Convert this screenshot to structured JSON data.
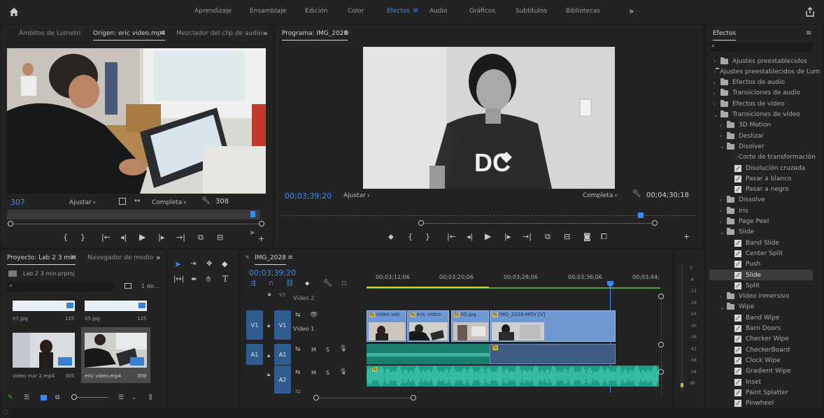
{
  "topbar": {
    "workspaces": [
      "Aprendizaje",
      "Ensamblaje",
      "Edición",
      "Color",
      "Efectos",
      "Audio",
      "Gráficos",
      "Subtítulos",
      "Bibliotecas"
    ],
    "active_workspace": "Efectos",
    "more": "»"
  },
  "source_panel": {
    "tabs": [
      "Ámbitos de Lumetri",
      "Origen: eric video.mp4",
      "Mezclador del clip de audio:"
    ],
    "active_tab": "Origen: eric video.mp4",
    "more": "»",
    "timecode_in": "307",
    "fit": "Ajustar",
    "quality": "Completa",
    "timecode_out": "308",
    "playhead_fraction": 0.98
  },
  "program_panel": {
    "title": "Programa: IMG_2028",
    "timecode_in": "00;03;39;20",
    "fit": "Ajustar",
    "quality": "Completa",
    "timecode_out": "00;04;30;18",
    "playhead_fraction": 0.96
  },
  "project_panel": {
    "tabs": [
      "Proyecto: Lab 2 3 min",
      "Navegador de medio"
    ],
    "active_tab": "Proyecto: Lab 2 3 min",
    "more": "»",
    "project_file": "Lab 2 3 min.prproj",
    "selection_count": "1 de...",
    "items": [
      {
        "name": "07.jpg",
        "meta": "125"
      },
      {
        "name": "05.jpg",
        "meta": "125"
      },
      {
        "name": "video mar 2.mp4",
        "meta": "305"
      },
      {
        "name": "eric video.mp4",
        "meta": "308"
      }
    ]
  },
  "timeline": {
    "sequence": "IMG_2028",
    "timecode": "00;03;39;20",
    "ruler": [
      "00;03;12;06",
      "00;03;20;06",
      "00;03;28;06",
      "00;03;36;06",
      "00;03;44;"
    ],
    "tracks": {
      "v2_label": "V2",
      "v2_name": "Vídeo 2",
      "v1_src": "V1",
      "v1_label": "V1",
      "v1_name": "Vídeo 1",
      "a1_src": "A1",
      "a1_label": "A1",
      "a2_label": "A2"
    },
    "mute": "M",
    "solo": "S",
    "clips": [
      "video seb",
      "eric video",
      "05.jpg",
      "IMG_2028.MOV [V]"
    ],
    "fx_badge": "fx"
  },
  "meter": {
    "ticks": [
      "0",
      "-6",
      "-12",
      "-18",
      "-24",
      "-30",
      "-36",
      "-42",
      "-48",
      "-54",
      "dB"
    ]
  },
  "effects_panel": {
    "title": "Efectos",
    "tree": [
      {
        "label": "Ajustes preestablecidos",
        "level": 0,
        "kind": "folder",
        "chev": "›"
      },
      {
        "label": "Ajustes preestablecidos de Lum",
        "level": 0,
        "kind": "folder",
        "chev": "›"
      },
      {
        "label": "Efectos de audio",
        "level": 0,
        "kind": "folder",
        "chev": "›"
      },
      {
        "label": "Transiciones de audio",
        "level": 0,
        "kind": "folder",
        "chev": "›"
      },
      {
        "label": "Efectos de vídeo",
        "level": 0,
        "kind": "folder",
        "chev": "›"
      },
      {
        "label": "Transiciones de vídeo",
        "level": 0,
        "kind": "folder",
        "chev": "⌄"
      },
      {
        "label": "3D Motion",
        "level": 1,
        "kind": "folder",
        "chev": "›"
      },
      {
        "label": "Deslizar",
        "level": 1,
        "kind": "folder",
        "chev": "›"
      },
      {
        "label": "Disolver",
        "level": 1,
        "kind": "folder",
        "chev": "⌄"
      },
      {
        "label": "Corte de transformación",
        "level": 2,
        "kind": "fx"
      },
      {
        "label": "Disolución cruzada",
        "level": 2,
        "kind": "fx"
      },
      {
        "label": "Pasar a blanco",
        "level": 2,
        "kind": "fx"
      },
      {
        "label": "Pasar a negro",
        "level": 2,
        "kind": "fx"
      },
      {
        "label": "Dissolve",
        "level": 1,
        "kind": "folder",
        "chev": "›"
      },
      {
        "label": "Iris",
        "level": 1,
        "kind": "folder",
        "chev": "›"
      },
      {
        "label": "Page Peel",
        "level": 1,
        "kind": "folder",
        "chev": "›"
      },
      {
        "label": "Slide",
        "level": 1,
        "kind": "folder",
        "chev": "⌄"
      },
      {
        "label": "Band Slide",
        "level": 2,
        "kind": "fx"
      },
      {
        "label": "Center Split",
        "level": 2,
        "kind": "fx"
      },
      {
        "label": "Push",
        "level": 2,
        "kind": "fx"
      },
      {
        "label": "Slide",
        "level": 2,
        "kind": "fx",
        "selected": true
      },
      {
        "label": "Split",
        "level": 2,
        "kind": "fx"
      },
      {
        "label": "Vídeo inmersivo",
        "level": 1,
        "kind": "folder",
        "chev": "›"
      },
      {
        "label": "Wipe",
        "level": 1,
        "kind": "folder",
        "chev": "⌄"
      },
      {
        "label": "Band Wipe",
        "level": 2,
        "kind": "fx"
      },
      {
        "label": "Barn Doors",
        "level": 2,
        "kind": "fx"
      },
      {
        "label": "Checker Wipe",
        "level": 2,
        "kind": "fx"
      },
      {
        "label": "CheckerBoard",
        "level": 2,
        "kind": "fx"
      },
      {
        "label": "Clock Wipe",
        "level": 2,
        "kind": "fx"
      },
      {
        "label": "Gradient Wipe",
        "level": 2,
        "kind": "fx"
      },
      {
        "label": "Inset",
        "level": 2,
        "kind": "fx"
      },
      {
        "label": "Paint Splatter",
        "level": 2,
        "kind": "fx"
      },
      {
        "label": "Pinwheel",
        "level": 2,
        "kind": "fx"
      }
    ]
  },
  "colors": {
    "accent": "#3b8cf0",
    "clip_video": "#6f97d1",
    "clip_audio": "#1f9c86",
    "work_area": "#d6c43a",
    "track_src": "#2f5d8f"
  }
}
